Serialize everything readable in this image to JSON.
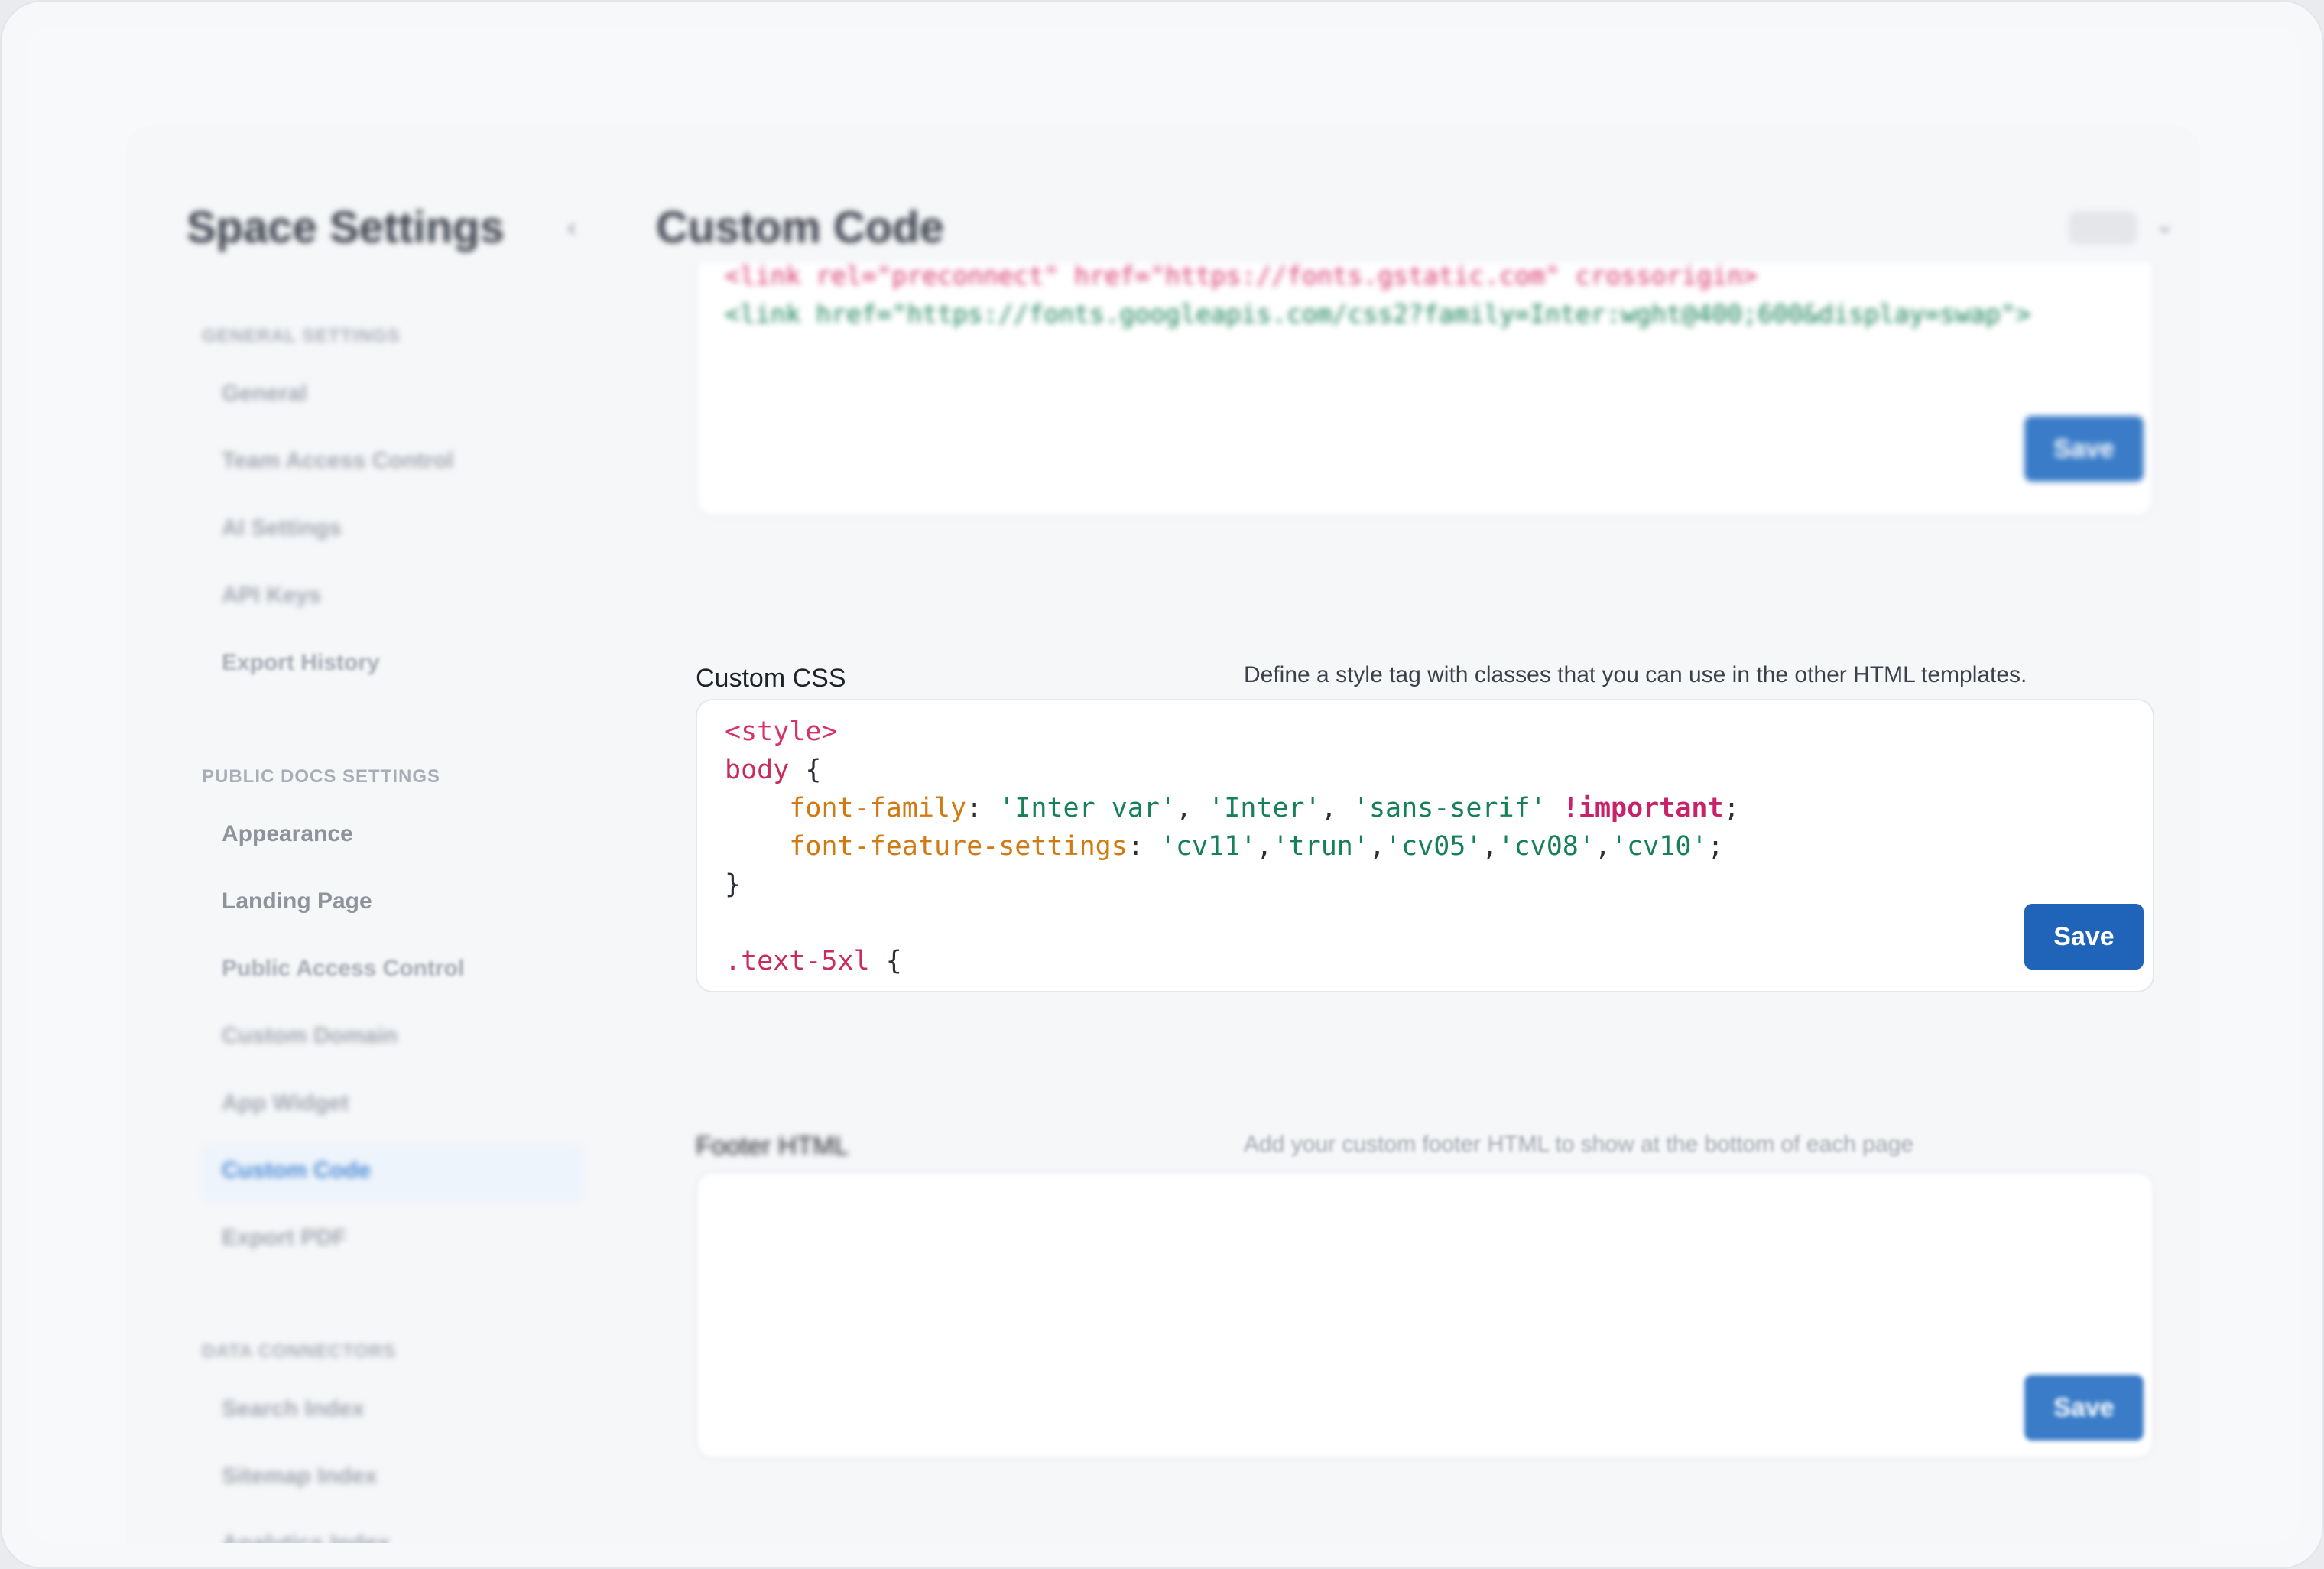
{
  "sidebar": {
    "title": "Space Settings",
    "sections": [
      {
        "label": "GENERAL SETTINGS",
        "items": [
          "General",
          "Team Access Control",
          "AI Settings",
          "API Keys",
          "Export History"
        ]
      },
      {
        "label": "PUBLIC DOCS SETTINGS",
        "items": [
          "Appearance",
          "Landing Page",
          "Public Access Control",
          "Custom Domain",
          "App Widget",
          "Custom Code",
          "Export PDF"
        ]
      },
      {
        "label": "DATA CONNECTORS",
        "items": [
          "Search Index",
          "Sitemap Index",
          "Analytics Index"
        ]
      }
    ],
    "active_item": "Custom Code"
  },
  "header": {
    "title": "Custom Code"
  },
  "head_html": {
    "code_lines": [
      "<link rel=\"preconnect\" href=\"https://fonts.gstatic.com\" crossorigin>",
      "<link href=\"https://fonts.googleapis.com/css2?family=Inter:wght@400;600&display=swap\">"
    ],
    "save_label": "Save"
  },
  "custom_css": {
    "label": "Custom CSS",
    "description": "Define a style tag with classes that you can use in the other HTML templates.",
    "save_label": "Save",
    "code": {
      "open_tag": "<style>",
      "body_selector": "body",
      "prop1": "font-family",
      "val1a": "'Inter var'",
      "val1b": "'Inter'",
      "val1c": "'sans-serif'",
      "important": "!important",
      "prop2": "font-feature-settings",
      "val2a": "'cv11'",
      "val2b": "'trun'",
      "val2c": "'cv05'",
      "val2d": "'cv08'",
      "val2e": "'cv10'",
      "close_brace": "}",
      "selector2": ".text-5xl",
      "open_brace": "{"
    }
  },
  "footer_html": {
    "label": "Footer HTML",
    "description": "Add your custom footer HTML to show at the bottom of each page",
    "save_label": "Save"
  }
}
